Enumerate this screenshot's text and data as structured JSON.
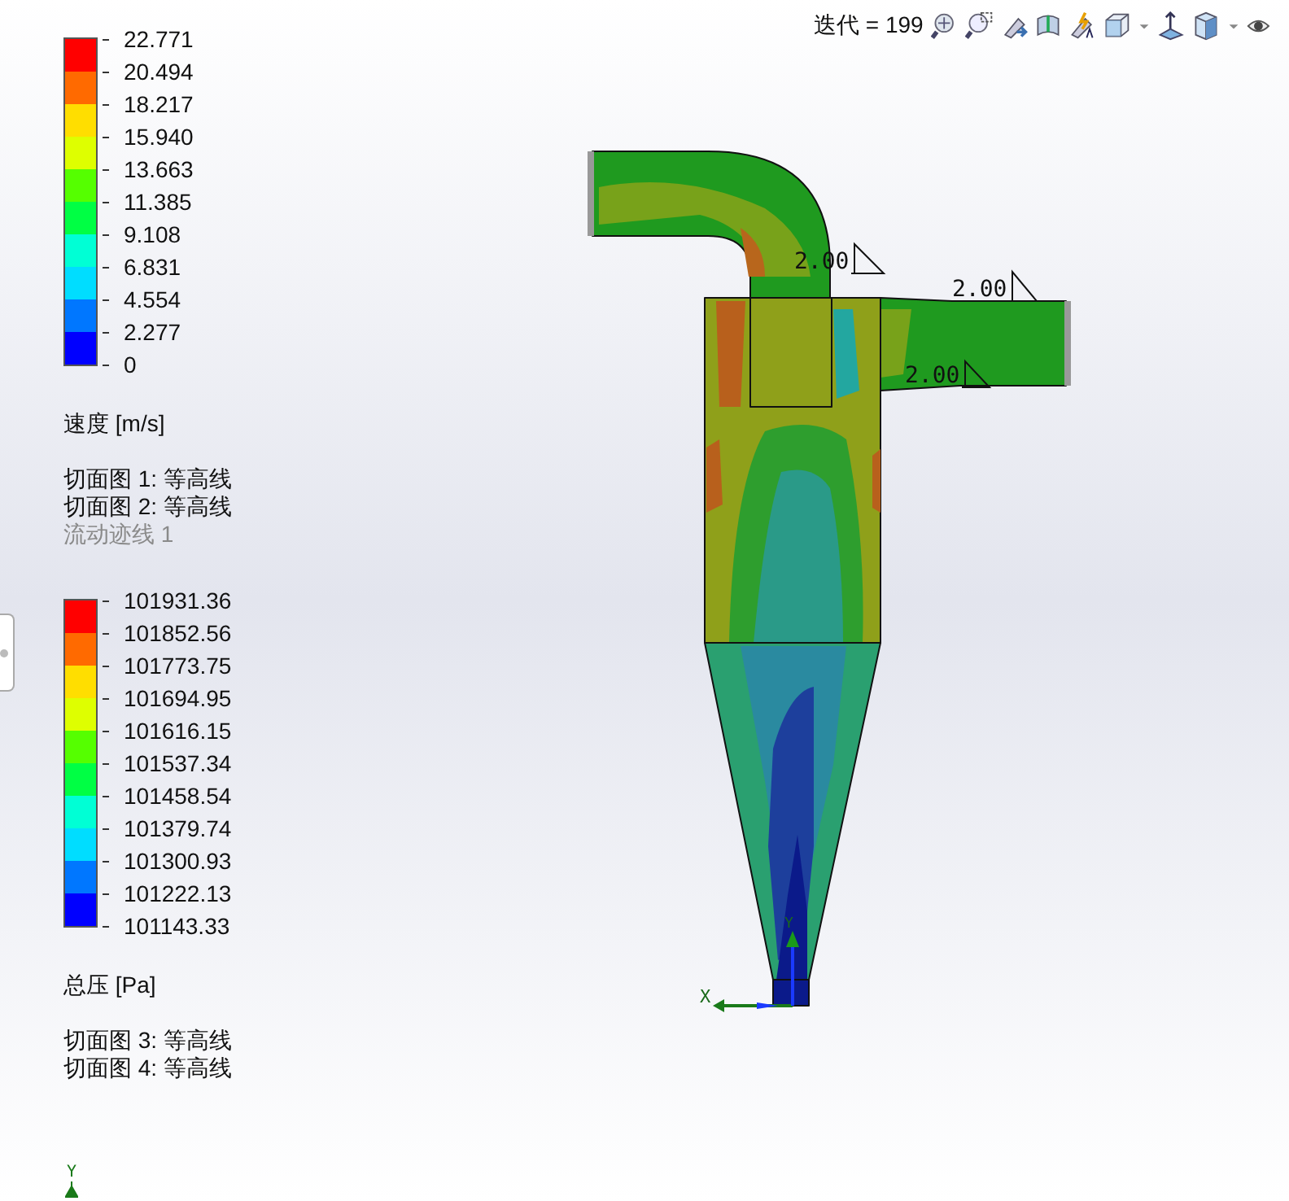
{
  "toolbar": {
    "iteration_label": "迭代 = 199"
  },
  "legends": [
    {
      "bands": [
        {
          "color": "#ff0000"
        },
        {
          "color": "#ff6a00"
        },
        {
          "color": "#ffde00"
        },
        {
          "color": "#deff00"
        },
        {
          "color": "#55ff00"
        },
        {
          "color": "#00ff44"
        },
        {
          "color": "#00ffd5"
        },
        {
          "color": "#00ddff"
        },
        {
          "color": "#0077ff"
        },
        {
          "color": "#0000ff"
        }
      ],
      "ticks": [
        "22.771",
        "20.494",
        "18.217",
        "15.940",
        "13.663",
        "11.385",
        "9.108",
        "6.831",
        "4.554",
        "2.277",
        "0"
      ],
      "unit": "速度 [m/s]",
      "entries": [
        {
          "text": "切面图 1: 等高线",
          "dimmed": false
        },
        {
          "text": "切面图 2: 等高线",
          "dimmed": false
        },
        {
          "text": "流动迹线 1",
          "dimmed": true
        }
      ]
    },
    {
      "bands": [
        {
          "color": "#ff0000"
        },
        {
          "color": "#ff6a00"
        },
        {
          "color": "#ffde00"
        },
        {
          "color": "#deff00"
        },
        {
          "color": "#55ff00"
        },
        {
          "color": "#00ff44"
        },
        {
          "color": "#00ffd5"
        },
        {
          "color": "#00ddff"
        },
        {
          "color": "#0077ff"
        },
        {
          "color": "#0000ff"
        }
      ],
      "ticks": [
        "101931.36",
        "101852.56",
        "101773.75",
        "101694.95",
        "101616.15",
        "101537.34",
        "101458.54",
        "101379.74",
        "101300.93",
        "101222.13",
        "101143.33"
      ],
      "unit": "总压 [Pa]",
      "entries": [
        {
          "text": "切面图 3: 等高线",
          "dimmed": false
        },
        {
          "text": "切面图 4: 等高线",
          "dimmed": false
        }
      ]
    }
  ],
  "model": {
    "dimension_labels": [
      "2.00",
      "2.00",
      "2.00"
    ],
    "axis_labels": [
      "X",
      "Y"
    ]
  },
  "corner_triad": {
    "label": "Y"
  }
}
